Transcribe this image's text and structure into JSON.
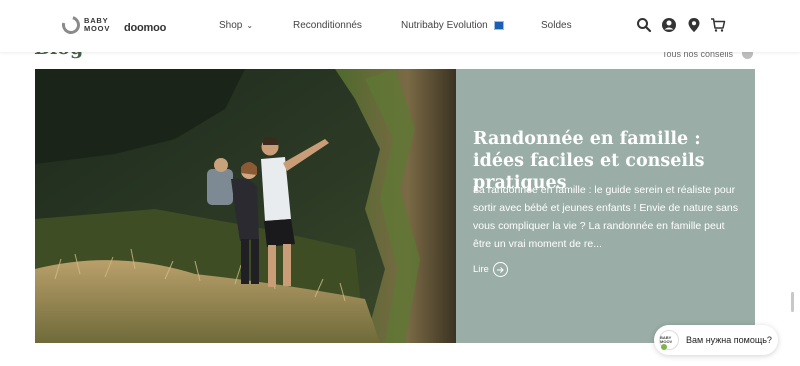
{
  "header": {
    "brand": "BABY MOOV",
    "brand_line1": "BABY",
    "brand_line2": "MOOV",
    "secondary_brand": "doomoo",
    "nav": [
      {
        "label": "Shop",
        "has_dropdown": true
      },
      {
        "label": "Reconditionnés"
      },
      {
        "label": "Nutribaby Evolution",
        "badge_color": "#1a5fb4"
      },
      {
        "label": "Soldes"
      }
    ],
    "icons": [
      "search-icon",
      "account-icon",
      "store-locator-icon",
      "cart-icon"
    ]
  },
  "blog": {
    "title": "Blog",
    "all_tips_label": "Tous nos conseils"
  },
  "article": {
    "title": "Randonnée en famille : idées faciles et conseils pratiques",
    "excerpt": "La randonnée en famille : le guide serein et réaliste pour sortir avec bébé et jeunes enfants !  Envie de nature sans vous compliquer la vie ? La randonnée en famille peut être un vrai moment de re...",
    "read_more": "Lire",
    "panel_color": "#9aada6"
  },
  "chat": {
    "label": "Вам нужна помощь?",
    "avatar_text": "BABY MOOV",
    "status_color": "#7ab648"
  },
  "colors": {
    "blog_title": "#456148",
    "accent_blue": "#1a5fb4"
  }
}
